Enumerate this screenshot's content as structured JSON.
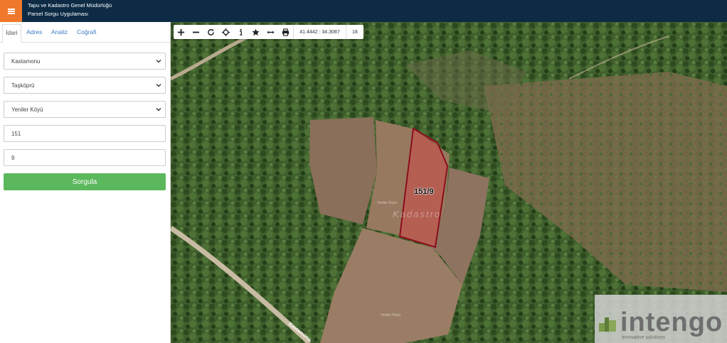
{
  "header": {
    "menu_icon": "hamburger-icon",
    "title_line1": "Tapu ve Kadastro Genel Müdürlüğü",
    "title_line2": "Parsel Sorgu Uygulaması",
    "accent_color": "#f0782d",
    "bar_color": "#0d2b45"
  },
  "sidebar": {
    "tabs": [
      {
        "label": "İdari",
        "active": true
      },
      {
        "label": "Adres",
        "active": false
      },
      {
        "label": "Analiz",
        "active": false
      },
      {
        "label": "Coğrafi",
        "active": false
      }
    ],
    "province": "Kastamonu",
    "district": "Taşköprü",
    "neighborhood": "Yeniler Köyü",
    "block_no": "151",
    "parcel_no": "9",
    "query_button": "Sorgula",
    "query_button_color": "#5cb85c"
  },
  "map": {
    "toolbar": {
      "tools": [
        "zoom-in-icon",
        "zoom-out-icon",
        "refresh-icon",
        "locate-icon",
        "info-icon",
        "star-icon",
        "measure-icon",
        "print-icon"
      ],
      "coordinates": "41.4442 : 34.3087",
      "zoom_level": "18"
    },
    "parcel_label": "151/9",
    "watermark_text": "Kadastro",
    "field_labels": [
      "Yeniler Köyü",
      "Yeniler Köyü"
    ],
    "road_name": "Kastamonu",
    "brand": {
      "word": "intengo",
      "subtitle": "innovative solutions"
    }
  }
}
